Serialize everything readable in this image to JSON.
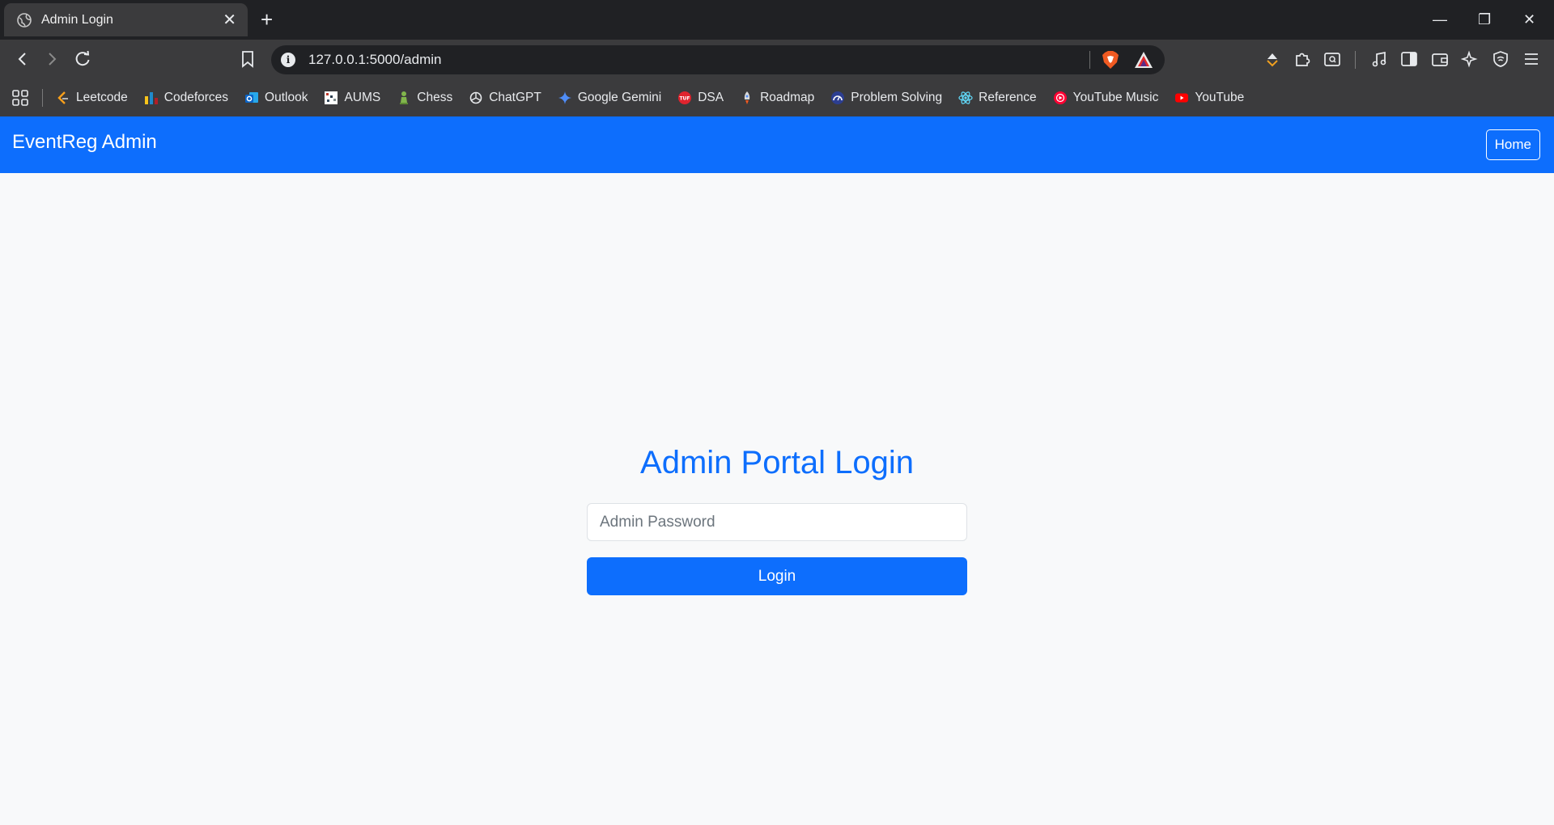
{
  "browser": {
    "tab_title": "Admin Login",
    "url": "127.0.0.1:5000/admin",
    "bookmarks": [
      {
        "label": "Leetcode",
        "icon": "leetcode-icon",
        "color": "#f89f1b"
      },
      {
        "label": "Codeforces",
        "icon": "codeforces-icon",
        "color": "#1f8acb"
      },
      {
        "label": "Outlook",
        "icon": "outlook-icon",
        "color": "#0a64c8"
      },
      {
        "label": "AUMS",
        "icon": "aums-icon",
        "color": "#ffffff"
      },
      {
        "label": "Chess",
        "icon": "chess-icon",
        "color": "#81b64c"
      },
      {
        "label": "ChatGPT",
        "icon": "chatgpt-icon",
        "color": "#e8eaed"
      },
      {
        "label": "Google Gemini",
        "icon": "gemini-icon",
        "color": "#4f8df7"
      },
      {
        "label": "DSA",
        "icon": "dsa-icon",
        "color": "#e0242e"
      },
      {
        "label": "Roadmap",
        "icon": "rocket-icon",
        "color": "#c8c8c8"
      },
      {
        "label": "Problem Solving",
        "icon": "problem-solving-icon",
        "color": "#2c3e91"
      },
      {
        "label": "Reference",
        "icon": "react-icon",
        "color": "#61dafb"
      },
      {
        "label": "YouTube Music",
        "icon": "youtube-music-icon",
        "color": "#ff0033"
      },
      {
        "label": "YouTube",
        "icon": "youtube-icon",
        "color": "#ff0000"
      }
    ]
  },
  "navbar": {
    "brand": "EventReg Admin",
    "home_label": "Home",
    "color": "#0d6efd"
  },
  "login": {
    "title": "Admin Portal Login",
    "password_placeholder": "Admin Password",
    "password_value": "",
    "button_label": "Login"
  }
}
